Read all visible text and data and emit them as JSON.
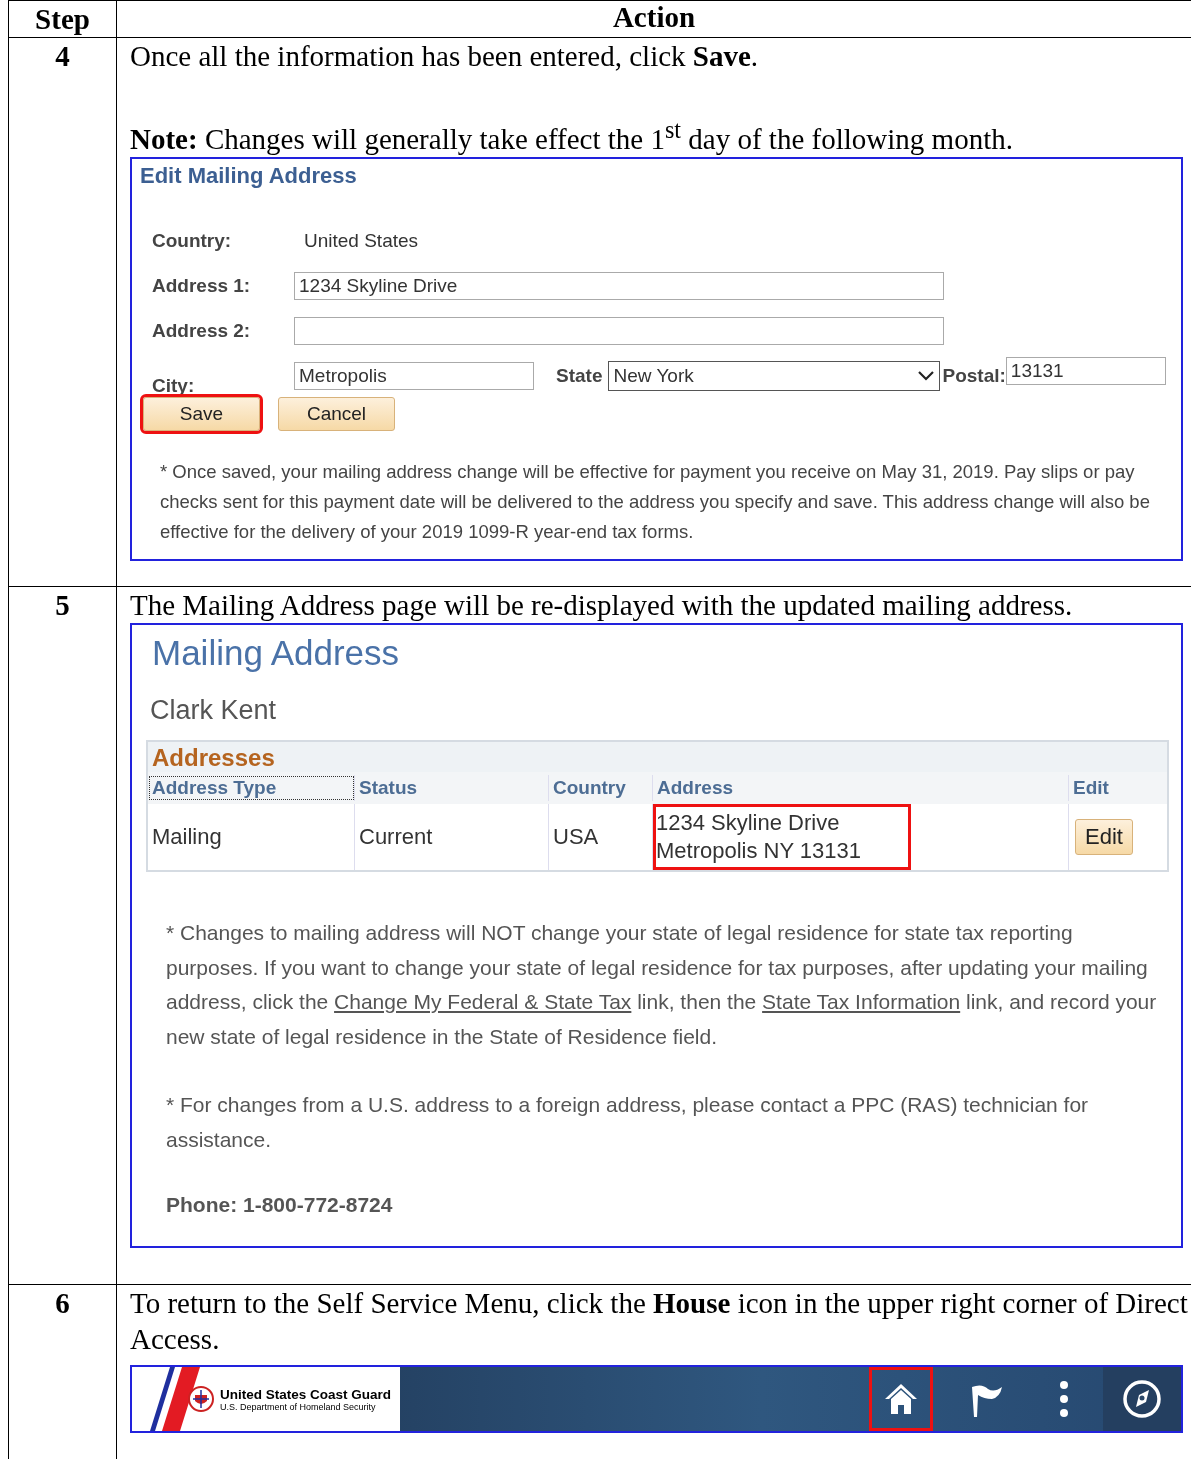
{
  "table": {
    "columns": [
      "Step",
      "Action"
    ],
    "step4": {
      "step": "4",
      "instruction": "Once all the information has been entered, click **Save**.",
      "note": "**Note:** Changes will generally take effect the 1$^{st}$ day of the following month.",
      "form": {
        "title": "Edit Mailing Address",
        "country": {
          "label": "Country:",
          "value": "United States"
        },
        "address1": {
          "label": "Address 1:",
          "value": "1234 Skyline Drive"
        },
        "address2": {
          "label": "Address 2:"
        },
        "city": {
          "label": "City:",
          "value": "Metropolis"
        },
        "state": {
          "label": "State",
          "value": "New York"
        },
        "postal": {
          "label": "Postal:",
          "value": "13131"
        },
        "buttons": [
          {
            "label": "Save",
            "highlighted": true
          },
          {
            "label": "Cancel",
            "highlighted": false
          }
        ],
        "footnote": "* Once saved, your mailing address change will be effective for payment you receive on May 31, 2019. Pay slips or pay checks sent for this payment date will be delivered to the address you specify and save. This address change will also be effective for the delivery of your 2019 1099-R year-end tax forms."
      }
    },
    "step5": {
      "step": "5",
      "instruction": "The Mailing Address page will be re-displayed with the updated mailing address.",
      "page": {
        "title": "Mailing Address",
        "name": "Clark Kent",
        "section": "Addresses",
        "columns": [
          "Address Type",
          "Status",
          "Country",
          "Address",
          "Edit"
        ],
        "row": {
          "type": "Mailing",
          "status": "Current",
          "country": "USA",
          "address_lines": [
            "1234 Skyline Drive",
            "Metropolis NY 13131"
          ],
          "address_highlighted": true,
          "edit": "Edit"
        },
        "notes": [
          [
            {
              "kind": "text",
              "text": "* Changes to mailing address will NOT change your state of legal residence for state tax reporting purposes. If you want to change your state of legal residence for tax purposes, after updating your mailing address, click the "
            },
            {
              "kind": "link",
              "text": "Change My Federal & State Tax"
            },
            {
              "kind": "text",
              "text": " link, then the "
            },
            {
              "kind": "link",
              "text": "State Tax Information"
            },
            {
              "kind": "text",
              "text": " link, and record your new state of legal residence in the State of Residence field."
            }
          ],
          [
            {
              "kind": "text",
              "text": "* For changes from a U.S. address to a foreign address, please contact a PPC (RAS) technician for assistance."
            }
          ]
        ],
        "phone": "Phone: 1-800-772-8724"
      }
    },
    "step6": {
      "step": "6",
      "instruction": "To return to the Self Service Menu, click the **House** icon in the upper right corner of Direct Access.",
      "banner": {
        "org": "United States Coast Guard",
        "dept": "U.S. Department of Homeland Security",
        "icons": [
          {
            "kind": "home",
            "highlighted": true
          },
          {
            "kind": "flag",
            "highlighted": false
          },
          {
            "kind": "more",
            "highlighted": false
          },
          {
            "kind": "compass",
            "highlighted": false
          }
        ]
      }
    }
  }
}
